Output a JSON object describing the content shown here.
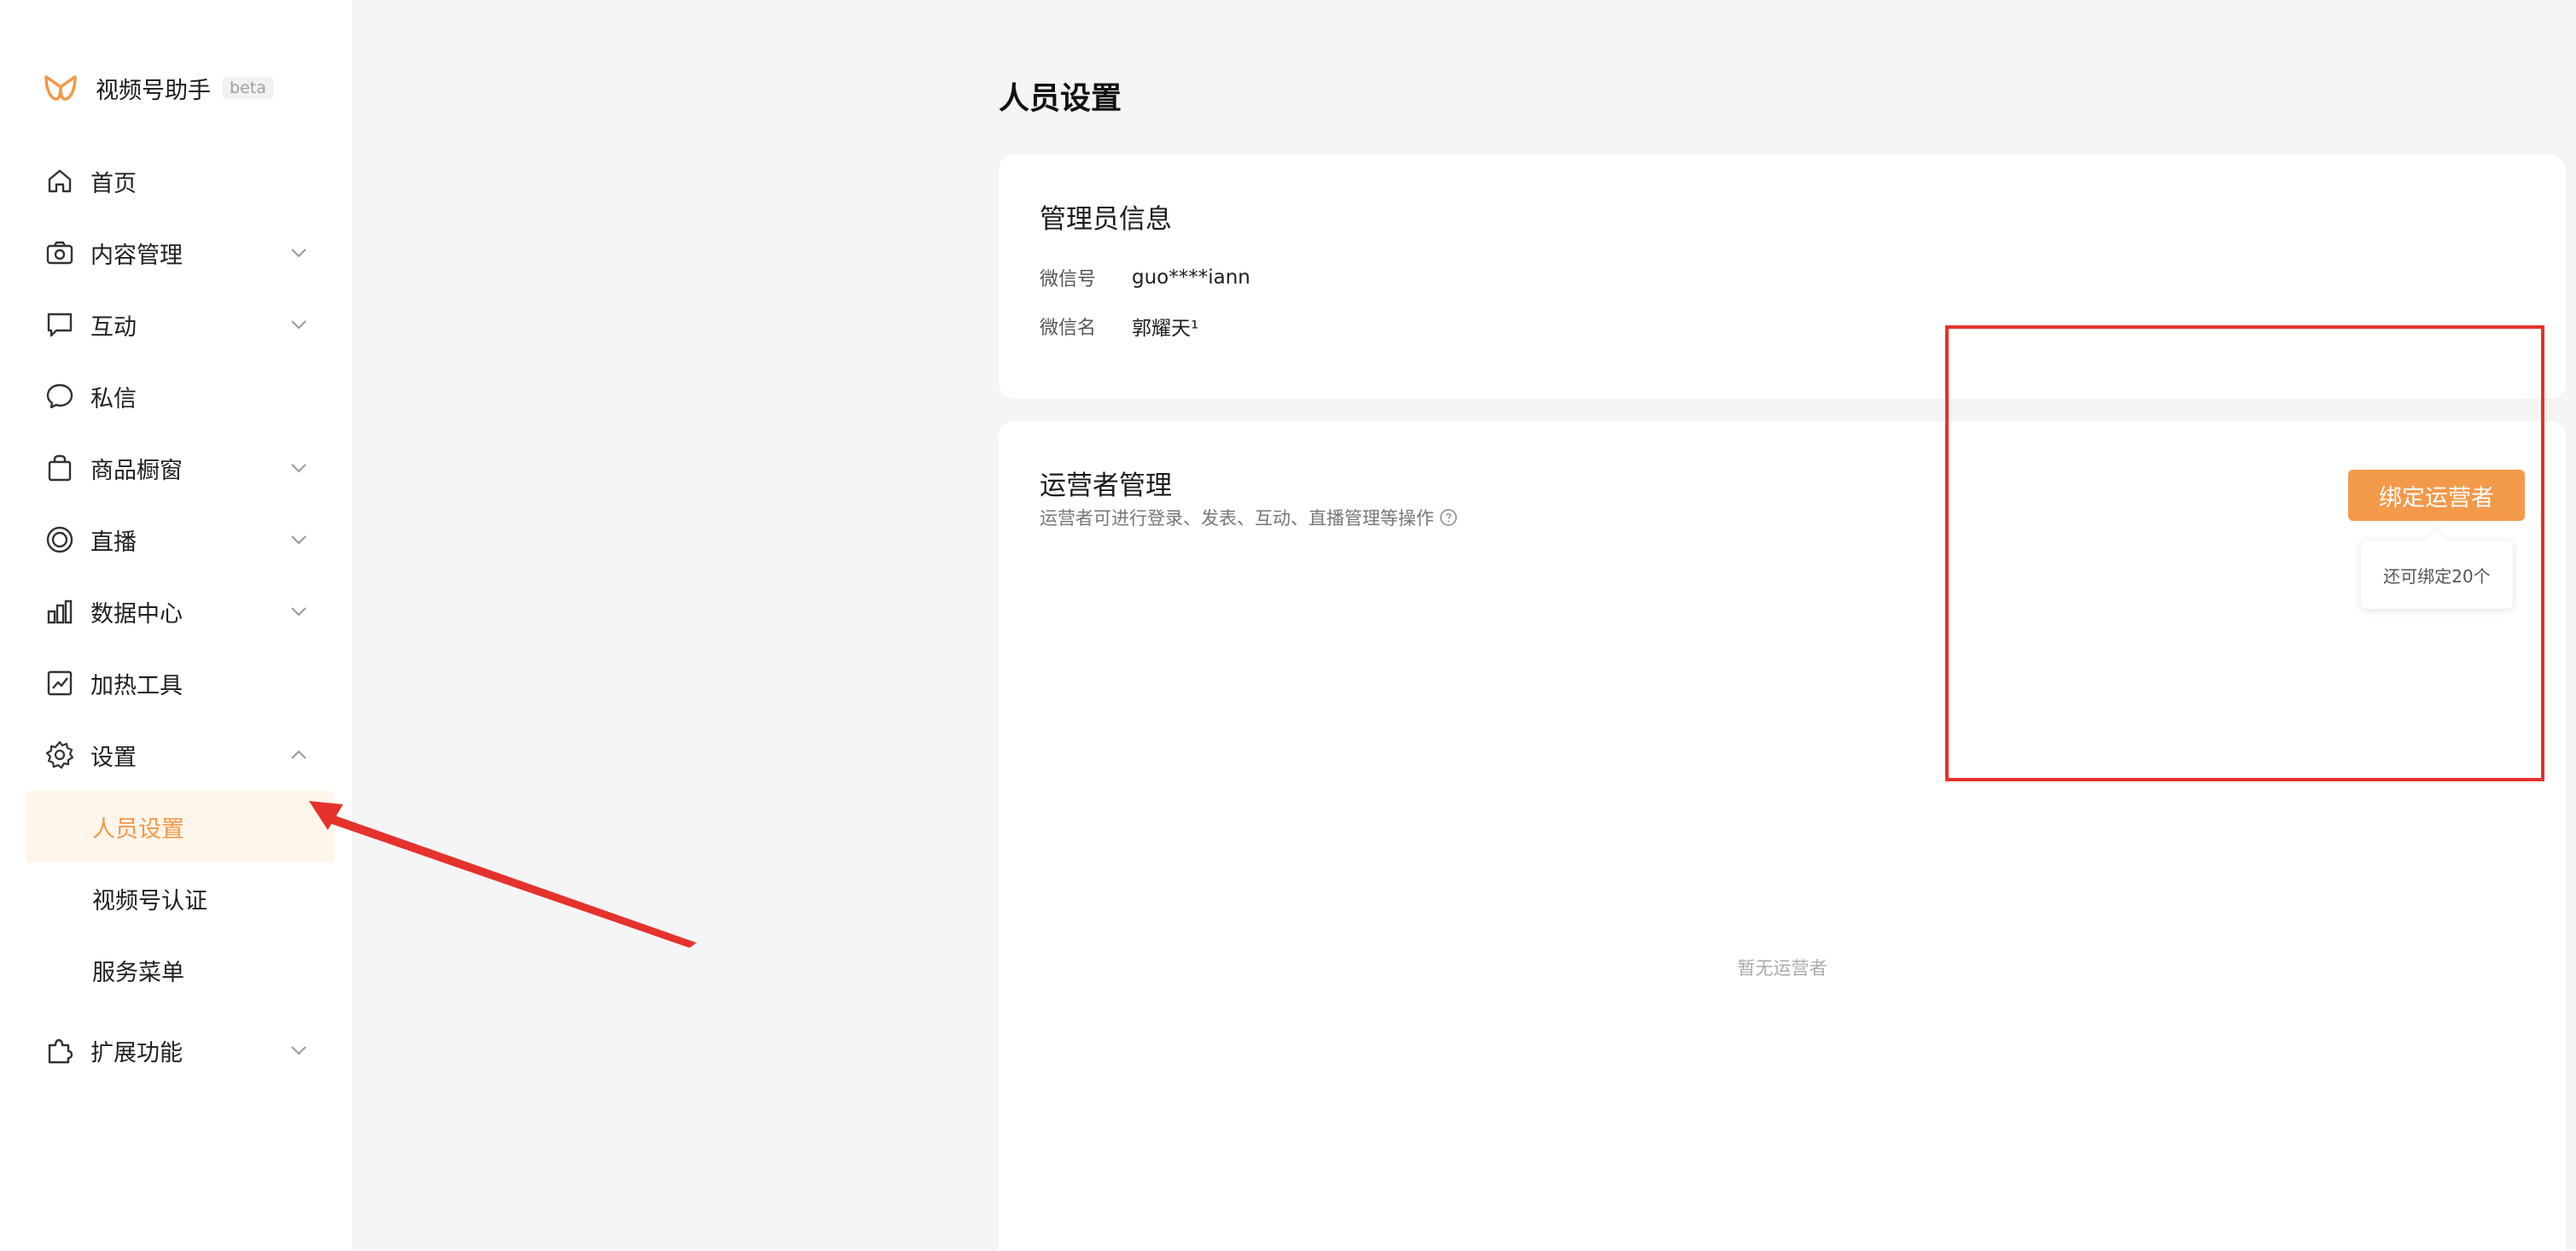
{
  "brand": {
    "name": "视频号助手",
    "badge": "beta"
  },
  "sidebar": {
    "items": [
      {
        "label": "首页",
        "icon": "home-icon"
      },
      {
        "label": "内容管理",
        "icon": "camera-icon"
      },
      {
        "label": "互动",
        "icon": "comment-icon"
      },
      {
        "label": "私信",
        "icon": "message-icon"
      },
      {
        "label": "商品橱窗",
        "icon": "shopping-bag-icon"
      },
      {
        "label": "直播",
        "icon": "live-icon"
      },
      {
        "label": "数据中心",
        "icon": "bar-chart-icon"
      },
      {
        "label": "加热工具",
        "icon": "trend-icon"
      },
      {
        "label": "设置",
        "icon": "gear-icon"
      },
      {
        "label": "扩展功能",
        "icon": "puzzle-icon"
      }
    ],
    "settings_sub": [
      {
        "label": "人员设置",
        "active": true
      },
      {
        "label": "视频号认证"
      },
      {
        "label": "服务菜单"
      }
    ]
  },
  "page": {
    "title": "人员设置"
  },
  "admin": {
    "title": "管理员信息",
    "wechat_id_label": "微信号",
    "wechat_id": "guo****iann",
    "wechat_name_label": "微信名",
    "wechat_name": "郭耀天¹"
  },
  "operators": {
    "title": "运营者管理",
    "description": "运营者可进行登录、发表、互动、直播管理等操作",
    "bind_button": "绑定运营者",
    "tooltip": "还可绑定20个",
    "empty": "暂无运营者"
  },
  "colors": {
    "accent": "#f2994a",
    "active_bg": "#fff5ea",
    "annotation": "#e5322d"
  }
}
